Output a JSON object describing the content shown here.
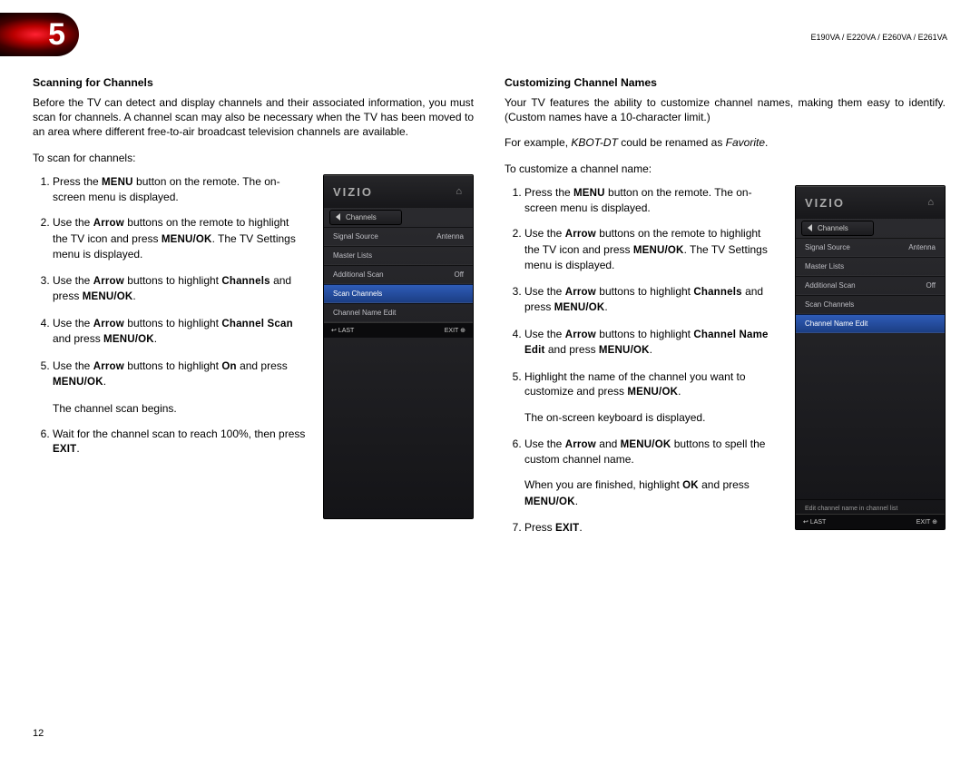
{
  "chapter_number": "5",
  "model_line": "E190VA / E220VA / E260VA / E261VA",
  "page_number": "12",
  "left": {
    "heading": "Scanning for Channels",
    "intro": "Before the TV can detect and display channels and their associated information, you must scan for channels. A channel scan may also be necessary when the TV has been moved to an area where different free-to-air broadcast television channels are available.",
    "lead": "To scan for channels:",
    "steps": {
      "s1a": "Press the ",
      "s1_key1": "MENU",
      "s1b": " button on the remote. The on-screen menu is displayed.",
      "s2a": "Use the ",
      "s2_key1": "Arrow",
      "s2b": " buttons on the remote to highlight the TV icon and press ",
      "s2_key2": "MENU/OK",
      "s2c": ". The TV Settings menu is displayed.",
      "s3a": "Use the ",
      "s3_key1": "Arrow",
      "s3b": " buttons to highlight ",
      "s3_key2": "Channels",
      "s3c": " and press ",
      "s3_key3": "MENU/OK",
      "s3d": ".",
      "s4a": "Use the ",
      "s4_key1": "Arrow",
      "s4b": " buttons to highlight ",
      "s4_key2": "Channel Scan",
      "s4c": " and press ",
      "s4_key3": "MENU/OK",
      "s4d": ".",
      "s5a": "Use the ",
      "s5_key1": "Arrow",
      "s5b": " buttons to highlight ",
      "s5_key2": "On",
      "s5c": " and press ",
      "s5_key3": "MENU/OK",
      "s5d": ".",
      "s5_sub": "The channel scan begins.",
      "s6a": "Wait for the channel scan to reach 100%, then press ",
      "s6_key1": "EXIT",
      "s6b": "."
    },
    "device": {
      "brand": "VIZIO",
      "tab": "Channels",
      "rows": [
        {
          "label": "Signal Source",
          "value": "Antenna"
        },
        {
          "label": "Master Lists",
          "value": ""
        },
        {
          "label": "Additional Scan",
          "value": "Off"
        },
        {
          "label": "Scan Channels",
          "value": "",
          "selected": true
        },
        {
          "label": "Channel Name Edit",
          "value": ""
        }
      ],
      "last": "LAST",
      "exit": "EXIT"
    }
  },
  "right": {
    "heading": "Customizing Channel Names",
    "intro": "Your TV features the ability to customize channel names, making them easy to identify. (Custom names have a 10-character limit.)",
    "example_a": "For example, ",
    "example_i1": "KBOT-DT",
    "example_b": " could be renamed as ",
    "example_i2": "Favorite",
    "example_c": ".",
    "lead": "To customize a channel name:",
    "steps": {
      "s1a": "Press the ",
      "s1_key1": "MENU",
      "s1b": " button on the remote. The on-screen menu is displayed.",
      "s2a": "Use the ",
      "s2_key1": "Arrow",
      "s2b": " buttons on the remote to highlight the TV icon and press ",
      "s2_key2": "MENU/OK",
      "s2c": ". The TV Settings menu is displayed.",
      "s3a": "Use the ",
      "s3_key1": "Arrow",
      "s3b": " buttons to highlight ",
      "s3_key2": "Channels",
      "s3c": " and press ",
      "s3_key3": "MENU/OK",
      "s3d": ".",
      "s4a": "Use the ",
      "s4_key1": "Arrow",
      "s4b": " buttons to highlight ",
      "s4_key2": "Channel Name Edit",
      "s4c": " and press ",
      "s4_key3": "MENU/OK",
      "s4d": ".",
      "s5a": "Highlight the name of the channel you want to customize and press ",
      "s5_key1": "MENU/OK",
      "s5b": ".",
      "s5_sub": "The on-screen keyboard is displayed.",
      "s6a": "Use the ",
      "s6_key1": "Arrow",
      "s6b": " and ",
      "s6_key2": "MENU/OK",
      "s6c": " buttons to spell the custom channel name.",
      "s6_suba": "When you are finished, highlight ",
      "s6_subkey": "OK",
      "s6_subb": " and press ",
      "s6_subkey2": "MENU/OK",
      "s6_subc": ".",
      "s7a": "Press ",
      "s7_key1": "EXIT",
      "s7b": "."
    },
    "device": {
      "brand": "VIZIO",
      "tab": "Channels",
      "rows": [
        {
          "label": "Signal Source",
          "value": "Antenna"
        },
        {
          "label": "Master Lists",
          "value": ""
        },
        {
          "label": "Additional Scan",
          "value": "Off"
        },
        {
          "label": "Scan Channels",
          "value": ""
        },
        {
          "label": "Channel Name Edit",
          "value": "",
          "selected": true
        }
      ],
      "help": "Edit channel name in channel list",
      "last": "LAST",
      "exit": "EXIT"
    }
  }
}
